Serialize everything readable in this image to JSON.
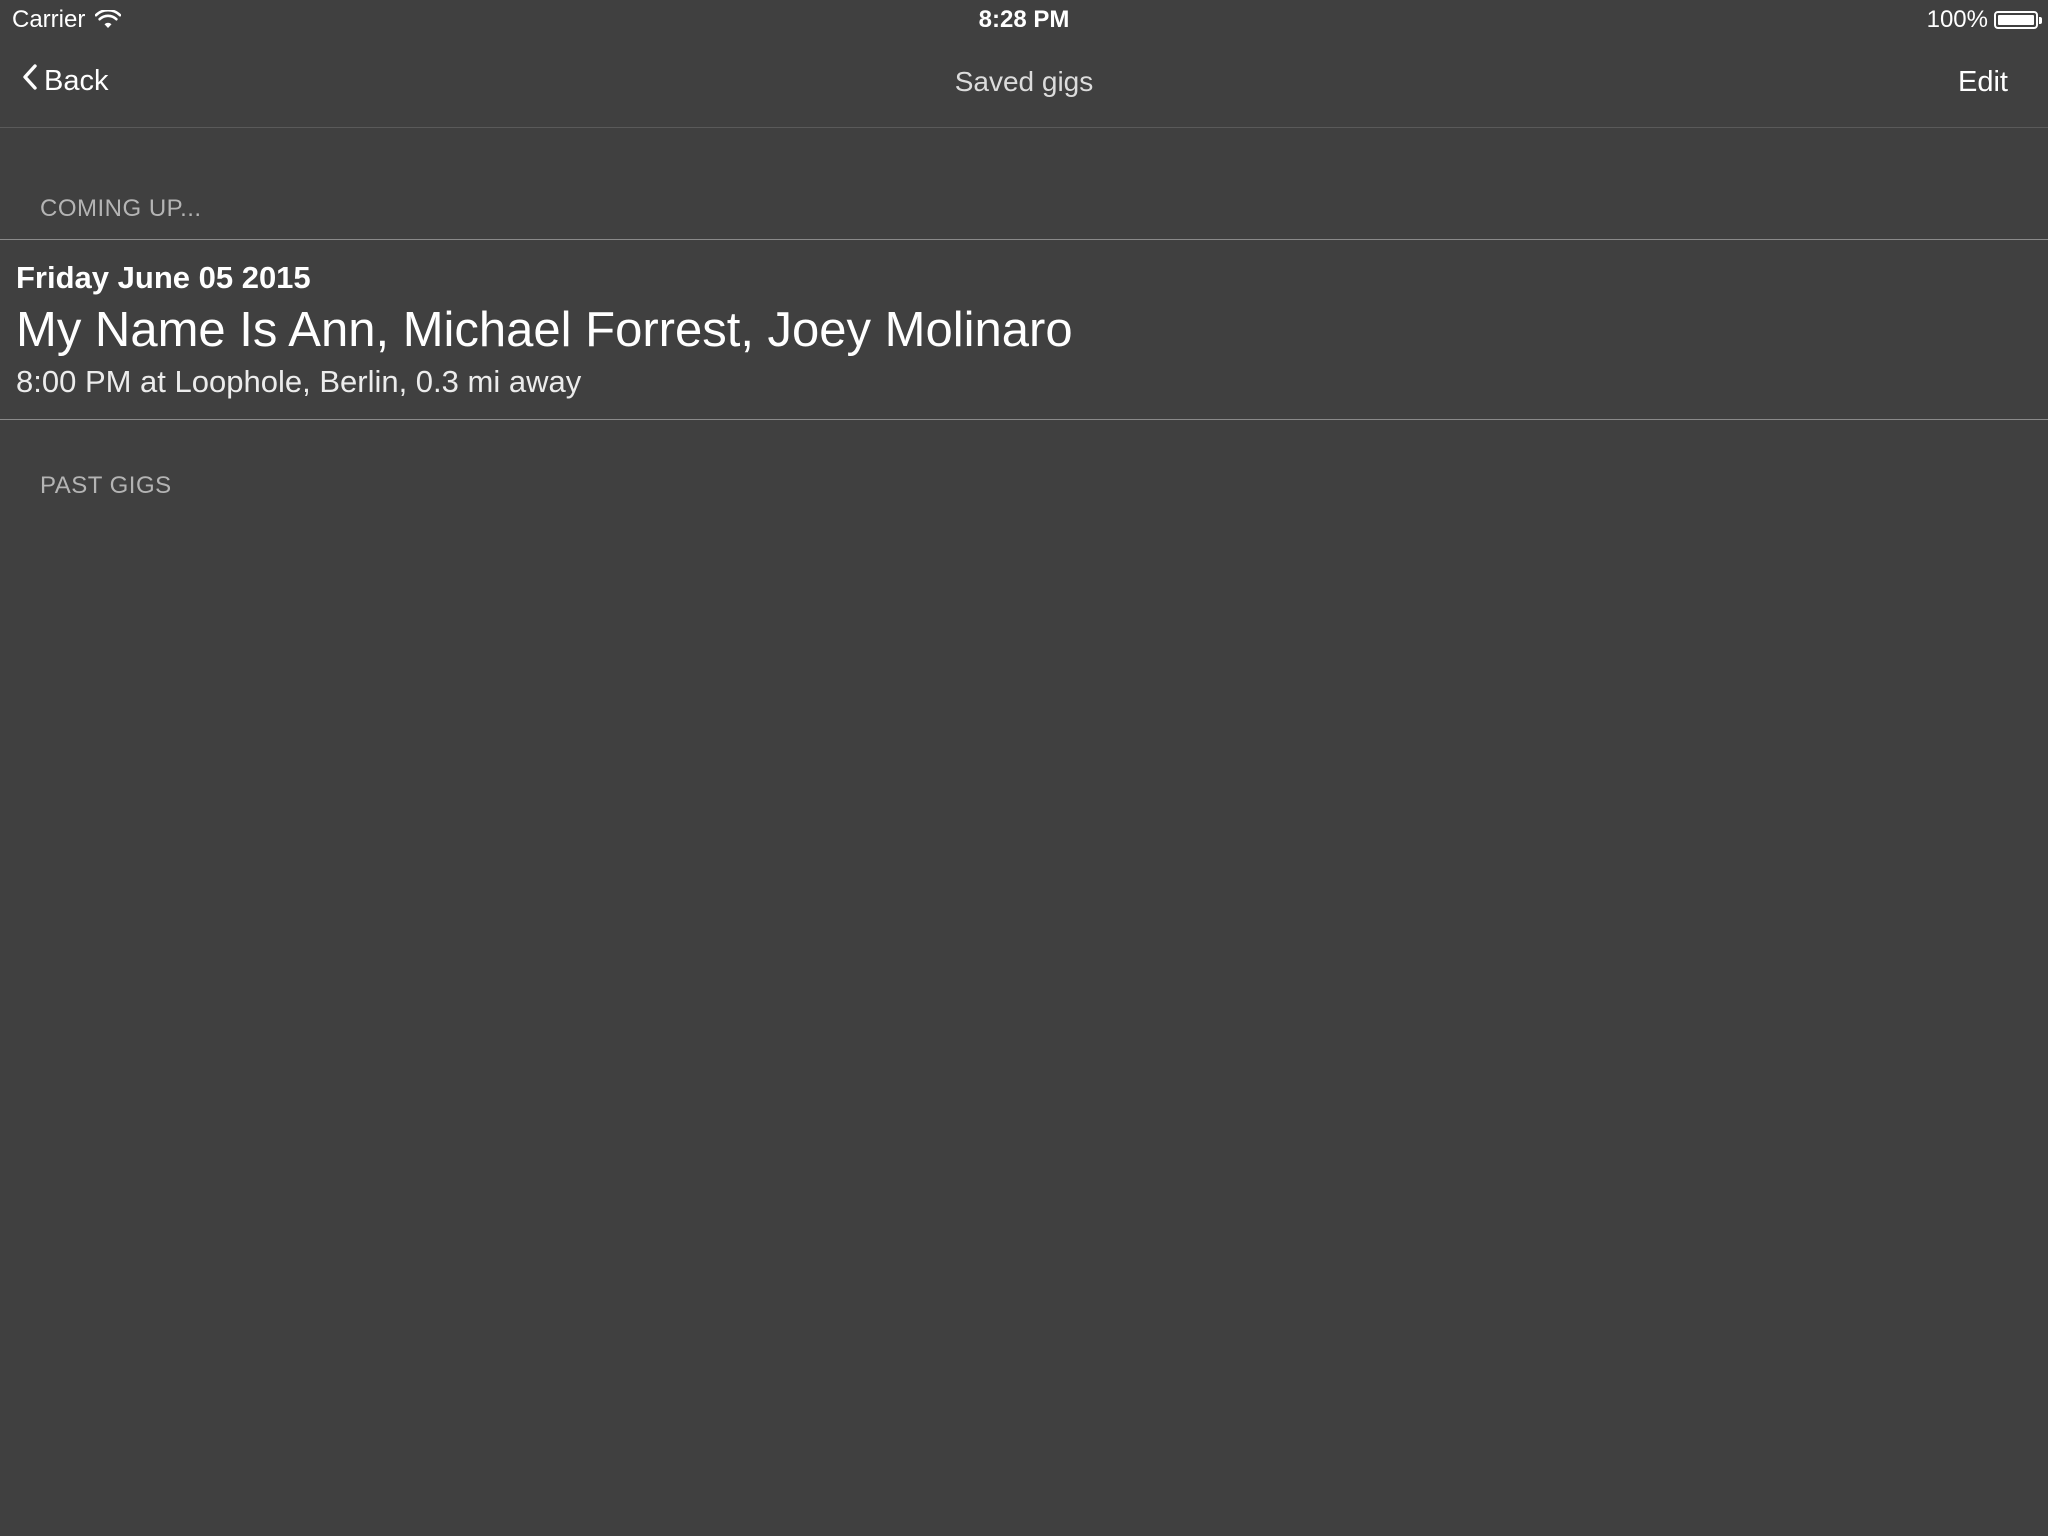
{
  "status_bar": {
    "carrier": "Carrier",
    "time": "8:28 PM",
    "battery": "100%",
    "battery_level": 1.0
  },
  "nav": {
    "back_label": "Back",
    "title": "Saved gigs",
    "edit_label": "Edit"
  },
  "sections": {
    "coming_up": "COMING UP...",
    "past_gigs": "PAST GIGS"
  },
  "gigs": [
    {
      "date": "Friday June 05 2015",
      "artists": "My Name Is Ann, Michael Forrest, Joey Molinaro",
      "details": "8:00 PM at Loophole, Berlin, 0.3 mi away"
    }
  ],
  "icons": {
    "wifi": "wifi-icon",
    "battery": "battery-icon",
    "back": "chevron-left-icon"
  }
}
